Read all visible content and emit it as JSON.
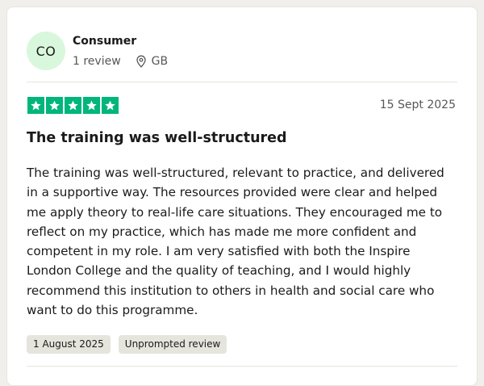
{
  "reviewer": {
    "initials": "CO",
    "name": "Consumer",
    "review_count": "1 review",
    "country": "GB"
  },
  "review": {
    "rating": 5,
    "date": "15 Sept 2025",
    "title": "The training was well-structured",
    "body": "The training was well-structured, relevant to practice, and delivered in a supportive way. The resources provided were clear and helped me apply theory to real-life care situations. They encouraged me to reflect on my practice, which has made me more confident and competent in my role. I am very satisfied with both the Inspire London College and the quality of teaching, and I would highly recommend this institution to others in health and social care who want to do this programme.",
    "experience_date": "1 August 2025",
    "review_type": "Unprompted review"
  },
  "icons": {
    "location": "location-pin-icon",
    "star": "star-icon"
  },
  "colors": {
    "star_green": "#00b67a",
    "avatar_bg": "#d9f7dc",
    "tag_bg": "#e5e5dd",
    "muted_text": "#575757"
  }
}
